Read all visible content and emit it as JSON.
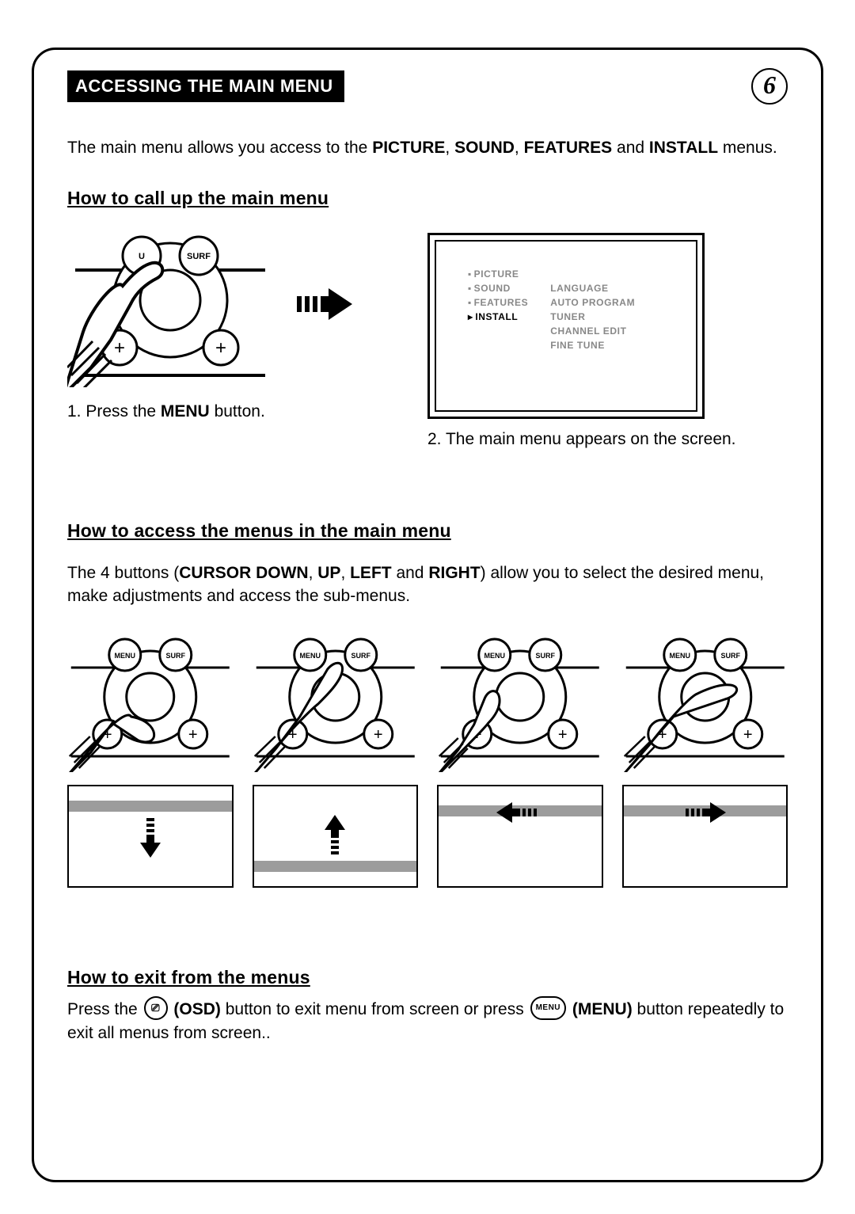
{
  "page_number": "6",
  "heading": "ACCESSING THE MAIN MENU",
  "intro_pre": "The main menu allows you access to the ",
  "intro_b1": "PICTURE",
  "intro_b2": "SOUND",
  "intro_b3": "FEATURES",
  "intro_and": " and ",
  "intro_b4": "INSTALL",
  "intro_post": " menus.",
  "sub1": "How to call up the main menu",
  "step1_pre": "1.  Press the ",
  "step1_b": "MENU",
  "step1_post": " button.",
  "step2": "2. The main menu appears on the screen.",
  "tv_menu": {
    "picture": "PICTURE",
    "sound": "SOUND",
    "features": "FEATURES",
    "install": "INSTALL",
    "language": "LANGUAGE",
    "auto_program": "AUTO PROGRAM",
    "tuner": "TUNER",
    "channel_edit": "CHANNEL EDIT",
    "fine_tune": "FINE TUNE"
  },
  "sub2": "How to access the menus in the main menu",
  "body2_pre": "The 4 buttons (",
  "body2_b1": "CURSOR DOWN",
  "body2_b2": "UP",
  "body2_b3": "LEFT",
  "body2_and": " and ",
  "body2_b4": "RIGHT",
  "body2_post": ") allow you to select the desired menu, make adjustments and access the sub-menus.",
  "sub3": "How to exit from the menus",
  "exit_pre": "Press the ",
  "exit_osd_label": "(OSD)",
  "exit_mid": " button to exit menu from screen or press ",
  "exit_menu_label": "(MENU)",
  "exit_post": " button repeatedly to exit all menus from screen..",
  "btn_menu_text": "MENU",
  "btn_surf_text": "SURF",
  "btn_osd_glyph": "⎚"
}
